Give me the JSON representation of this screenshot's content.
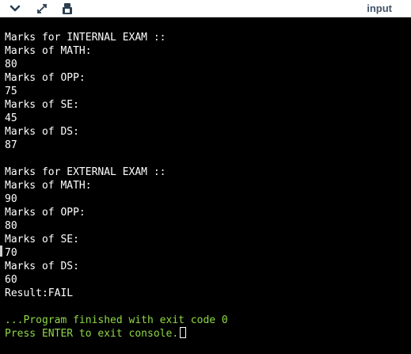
{
  "toolbar": {
    "icons": [
      "chevron-down-icon",
      "expand-arrows-icon",
      "stop-icon"
    ],
    "input_tab_label": "input"
  },
  "console": {
    "lines": [
      "Marks for INTERNAL EXAM ::",
      "Marks of MATH:",
      "80",
      "Marks of OPP:",
      "75",
      "Marks of SE:",
      "45",
      "Marks of DS:",
      "87",
      "",
      "Marks for EXTERNAL EXAM ::",
      "Marks of MATH:",
      "90",
      "Marks of OPP:",
      "80",
      "Marks of SE:",
      "70",
      "Marks of DS:",
      "60",
      "Result:FAIL",
      "",
      "...Program finished with exit code 0",
      "Press ENTER to exit console."
    ],
    "output_color": "#ffffff",
    "status_color": "#8fd846"
  }
}
